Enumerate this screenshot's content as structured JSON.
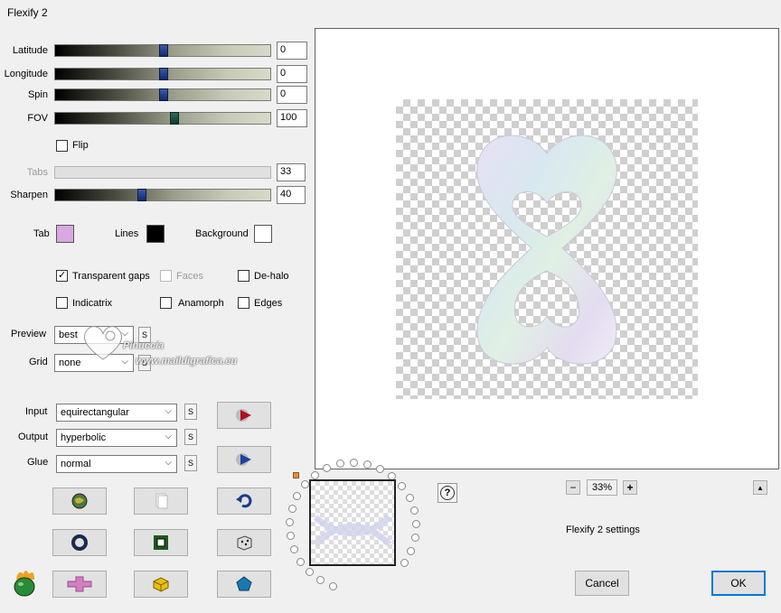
{
  "window": {
    "title": "Flexify 2"
  },
  "sliders": [
    {
      "label": "Latitude",
      "value": "0",
      "fraction": 0.5
    },
    {
      "label": "Longitude",
      "value": "0",
      "fraction": 0.5
    },
    {
      "label": "Spin",
      "value": "0",
      "fraction": 0.5
    },
    {
      "label": "FOV",
      "value": "100",
      "fraction": 0.55
    },
    {
      "label": "Tabs",
      "value": "33",
      "fraction": null,
      "disabled": true
    },
    {
      "label": "Sharpen",
      "value": "40",
      "fraction": 0.4
    }
  ],
  "flip": {
    "label": "Flip",
    "checked": false
  },
  "colors": {
    "tab_label": "Tab",
    "tab_color": "#d8a8e0",
    "lines_label": "Lines",
    "lines_color": "#000000",
    "background_label": "Background",
    "background_color": "#ffffff"
  },
  "options": {
    "transparent_gaps": {
      "label": "Transparent gaps",
      "checked": true
    },
    "faces": {
      "label": "Faces",
      "checked": false,
      "disabled": true
    },
    "dehalo": {
      "label": "De-halo",
      "checked": false
    },
    "indicatrix": {
      "label": "Indicatrix",
      "checked": false
    },
    "anamorph": {
      "label": "Anamorph",
      "checked": false
    },
    "edges": {
      "label": "Edges",
      "checked": false
    }
  },
  "preview_select": {
    "label": "Preview",
    "value": "best",
    "s": "S"
  },
  "grid_select": {
    "label": "Grid",
    "value": "none",
    "s": "S"
  },
  "watermark": {
    "line1": "Pinuccia",
    "line2": "www.maildigrafica.eu"
  },
  "input_select": {
    "label": "Input",
    "value": "equirectangular",
    "s": "S"
  },
  "output_select": {
    "label": "Output",
    "value": "hyperbolic",
    "s": "S"
  },
  "glue_select": {
    "label": "Glue",
    "value": "normal",
    "s": "S"
  },
  "zoom": {
    "minus": "−",
    "value": "33%",
    "plus": "+",
    "up": "▲"
  },
  "help": "?",
  "settings_text": "Flexify 2 settings",
  "buttons": {
    "cancel": "Cancel",
    "ok": "OK"
  },
  "icons": {
    "toolbar": [
      "globe-icon",
      "copy-icon",
      "undo-icon",
      "ring-icon",
      "frame-icon",
      "dice-icon",
      "cross-icon",
      "cube-icon",
      "pentagon-icon"
    ],
    "side": [
      "play-red-icon",
      "play-blue-icon"
    ],
    "logo": "flaming-egg-logo-icon"
  },
  "accent": "#0078d7"
}
